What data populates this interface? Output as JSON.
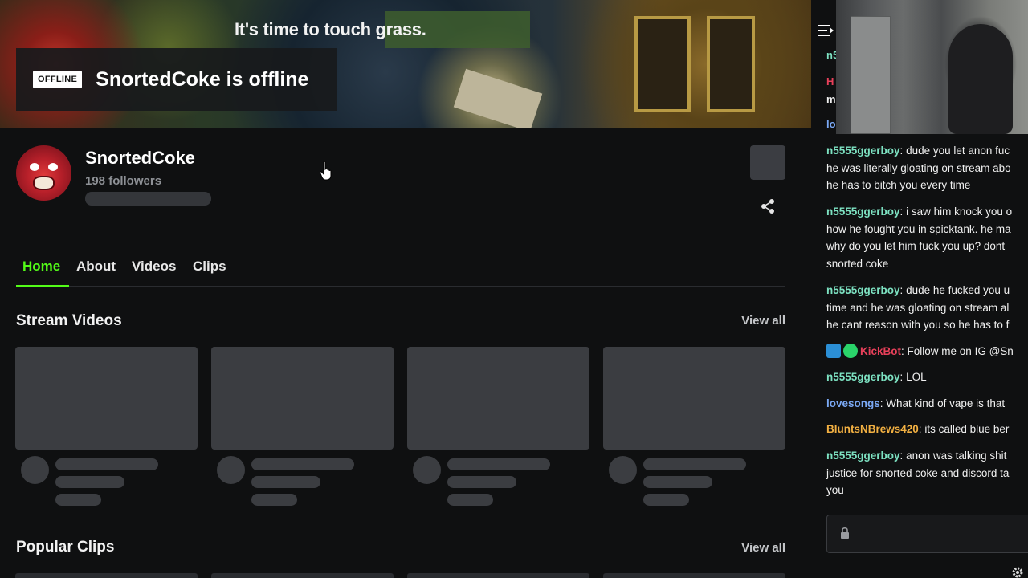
{
  "banner": {
    "slogan": "It's time to touch grass.",
    "offline_badge": "OFFLINE",
    "offline_text": "SnortedCoke is offline"
  },
  "channel": {
    "name": "SnortedCoke",
    "followers": "198 followers"
  },
  "tabs": [
    {
      "label": "Home",
      "active": true
    },
    {
      "label": "About",
      "active": false
    },
    {
      "label": "Videos",
      "active": false
    },
    {
      "label": "Clips",
      "active": false
    }
  ],
  "sections": {
    "stream_videos": {
      "title": "Stream Videos",
      "view_all": "View all"
    },
    "popular_clips": {
      "title": "Popular Clips",
      "view_all": "View all"
    }
  },
  "chat": {
    "partial_lines": [
      {
        "text": "n5",
        "color": "#7de2c2"
      },
      {
        "text": "H",
        "color": "#e8405a"
      },
      {
        "text": "m",
        "color": "#f0f0f0"
      },
      {
        "text": "lo",
        "color": "#7aa8f4"
      }
    ],
    "messages": [
      {
        "user": "n5555ggerboy",
        "color": "#7de2c2",
        "text": "dude you let anon fuc\nhe was literally gloating on stream abo\nhe has to bitch you every time"
      },
      {
        "user": "n5555ggerboy",
        "color": "#7de2c2",
        "text": "i saw him knock you o\nhow he fought you in spicktank. he ma\nwhy do you let him fuck you up? dont\nsnorted coke"
      },
      {
        "user": "n5555ggerboy",
        "color": "#7de2c2",
        "text": "dude he fucked you u\ntime and he was gloating on stream al\nhe cant reason with you so he has to f"
      },
      {
        "user": "KickBot",
        "color": "#e8405a",
        "text": "Follow me on IG @Sn",
        "badges": true
      },
      {
        "user": "n5555ggerboy",
        "color": "#7de2c2",
        "text": "LOL"
      },
      {
        "user": "lovesongs",
        "color": "#7aa8f4",
        "text": "What kind of vape is that"
      },
      {
        "user": "BluntsNBrews420",
        "color": "#f2b042",
        "text": "its called blue ber"
      },
      {
        "user": "n5555ggerboy",
        "color": "#7de2c2",
        "text": "anon was talking shit\njustice for snorted coke and discord ta\nyou"
      }
    ]
  },
  "colors": {
    "accent": "#53fc18",
    "skeleton": "#3b3d41"
  }
}
